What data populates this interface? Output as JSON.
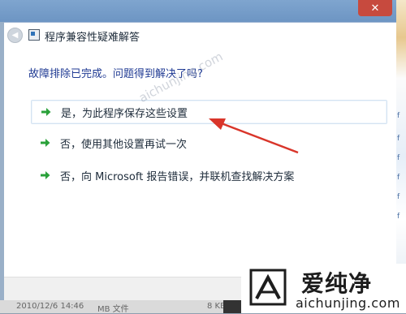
{
  "window": {
    "close_symbol": "✕"
  },
  "dialog": {
    "title": "程序兼容性疑难解答",
    "question": "故障排除已完成。问题得到解决了吗?",
    "options": [
      {
        "label": "是，为此程序保存这些设置",
        "selected": true
      },
      {
        "label": "否，使用其他设置再试一次",
        "selected": false
      },
      {
        "label": "否，向 Microsoft 报告错误，并联机查找解决方案",
        "selected": false
      }
    ]
  },
  "watermark": {
    "text": "aichunjing.com"
  },
  "statusbar": {
    "date": "2010/12/6 14:46",
    "type": "MB 文件",
    "size": "8 KB"
  },
  "logo": {
    "main": "爱纯净",
    "sub": "aichunjing.com"
  },
  "colors": {
    "accent_arrow": "#2aa13a",
    "annotation_red": "#d9352a",
    "question_blue": "#1f3a93"
  }
}
